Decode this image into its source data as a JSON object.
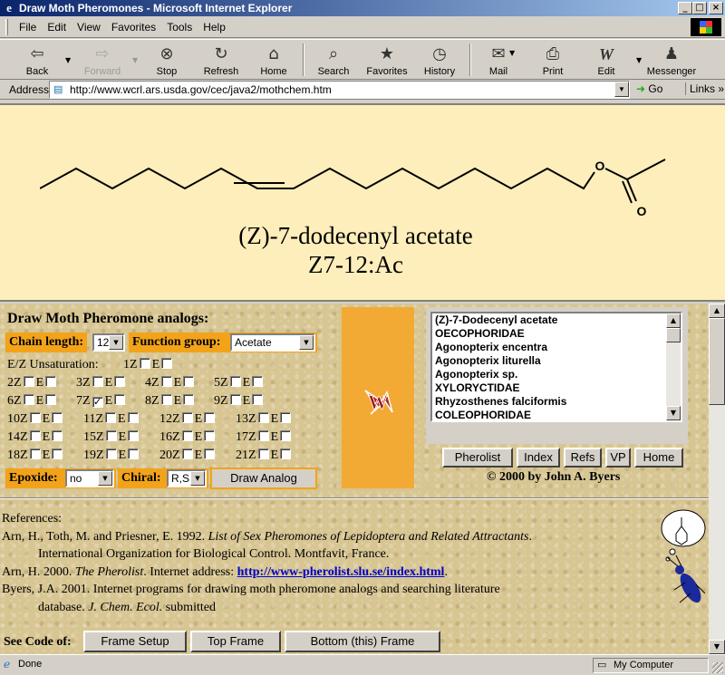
{
  "window": {
    "title": "Draw Moth Pheromones - Microsoft Internet Explorer",
    "controls": {
      "minimize": "_",
      "maximize": "□",
      "close": "×"
    }
  },
  "menu": [
    "File",
    "Edit",
    "View",
    "Favorites",
    "Tools",
    "Help"
  ],
  "toolbar": {
    "back": "Back",
    "forward": "Forward",
    "stop": "Stop",
    "refresh": "Refresh",
    "home": "Home",
    "search": "Search",
    "favorites": "Favorites",
    "history": "History",
    "mail": "Mail",
    "print": "Print",
    "edit": "Edit",
    "messenger": "Messenger"
  },
  "address": {
    "label": "Address",
    "url": "http://www.wcrl.ars.usda.gov/cec/java2/mothchem.htm",
    "go": "Go",
    "links": "Links"
  },
  "molecule": {
    "name": "(Z)-7-dodecenyl acetate",
    "code": "Z7-12:Ac",
    "atom_o1": "O",
    "atom_o2": "O"
  },
  "panel": {
    "title": "Draw Moth Pheromone analogs:",
    "chain_label": "Chain length:",
    "chain_value": "12",
    "function_label": "Function group:",
    "function_value": "Acetate",
    "ez_label": "E/Z Unsaturation:",
    "epoxide_label": "Epoxide:",
    "epoxide_value": "no",
    "chiral_label": "Chiral:",
    "chiral_value": "R,S",
    "draw_button": "Draw Analog",
    "z_letter": "Z",
    "e_letter": "E",
    "check_mark": "✓",
    "positions": [
      "1",
      "2",
      "3",
      "4",
      "5",
      "6",
      "7",
      "8",
      "9",
      "10",
      "11",
      "12",
      "13",
      "14",
      "15",
      "16",
      "17",
      "18",
      "19",
      "20",
      "21"
    ],
    "checked_z": 7
  },
  "species_list": [
    "(Z)-7-Dodecenyl acetate",
    "OECOPHORIDAE",
    "Agonopterix encentra",
    "Agonopterix liturella",
    "Agonopterix sp.",
    "XYLORYCTIDAE",
    "Rhyzosthenes falciformis",
    "COLEOPHORIDAE"
  ],
  "nav_buttons": [
    "Pherolist",
    "Index",
    "Refs",
    "VP",
    "Home"
  ],
  "copyright": "© 2000 by John A. Byers",
  "references": {
    "heading": "References:",
    "r1_a": "Arn, H., Toth, M. and Priesner, E. 1992. ",
    "r1_title": "List of Sex Pheromones of Lepidoptera and Related Attractants",
    "r1_b": ".",
    "r1_c": "International Organization for Biological Control. Montfavit, France.",
    "r2_a": "Arn, H. 2000. ",
    "r2_title": "The Pherolist",
    "r2_b": ". Internet address: ",
    "r2_link": "http://www-pherolist.slu.se/index.html",
    "r2_c": ".",
    "r3_a": "Byers, J.A. 2001. Internet programs for drawing moth pheromone analogs and searching literature",
    "r3_b": "database. ",
    "r3_journal": "J. Chem. Ecol.",
    "r3_c": " submitted"
  },
  "see_code": {
    "label": "See Code of:",
    "buttons": [
      "Frame Setup",
      "Top Frame",
      "Bottom (this) Frame"
    ]
  },
  "status": {
    "text": "Done",
    "zone": "My Computer"
  },
  "logo_letter": "W"
}
